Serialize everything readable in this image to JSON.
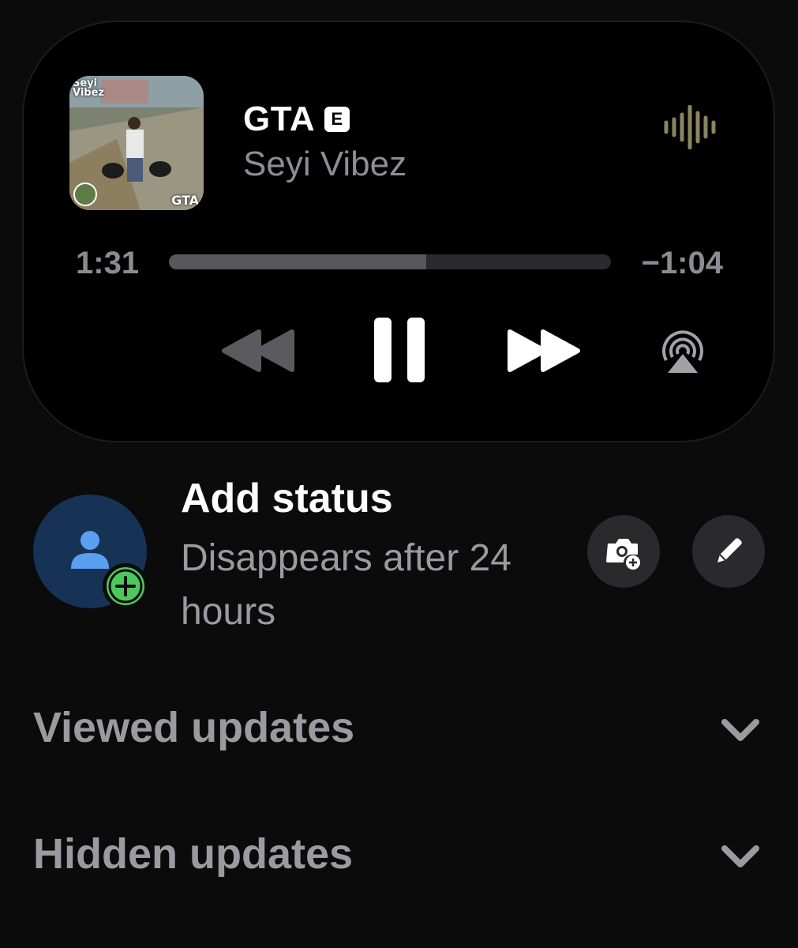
{
  "now_playing": {
    "title": "GTA",
    "explicit_label": "E",
    "artist": "Seyi Vibez",
    "artwork_text_top": "Seyi Vibez",
    "artwork_text_bottom": "GTA",
    "elapsed": "1:31",
    "remaining": "−1:04",
    "progress_fraction": 0.583,
    "icons": [
      "waveform-icon",
      "rewind-icon",
      "pause-icon",
      "fast-forward-icon",
      "airplay-icon"
    ]
  },
  "status": {
    "title": "Add status",
    "subtitle": "Disappears after 24 hours",
    "avatar_icon": "person-icon",
    "add_icon": "plus-icon",
    "camera_icon": "camera-plus-icon",
    "pencil_icon": "pencil-icon"
  },
  "sections": [
    {
      "label": "Viewed updates",
      "icon": "chevron-down-icon"
    },
    {
      "label": "Hidden updates",
      "icon": "chevron-down-icon"
    }
  ],
  "colors": {
    "background": "#0b0b0b",
    "avatar": "#163356",
    "add_badge": "#4cc85c",
    "waveform": "#8a8460"
  }
}
